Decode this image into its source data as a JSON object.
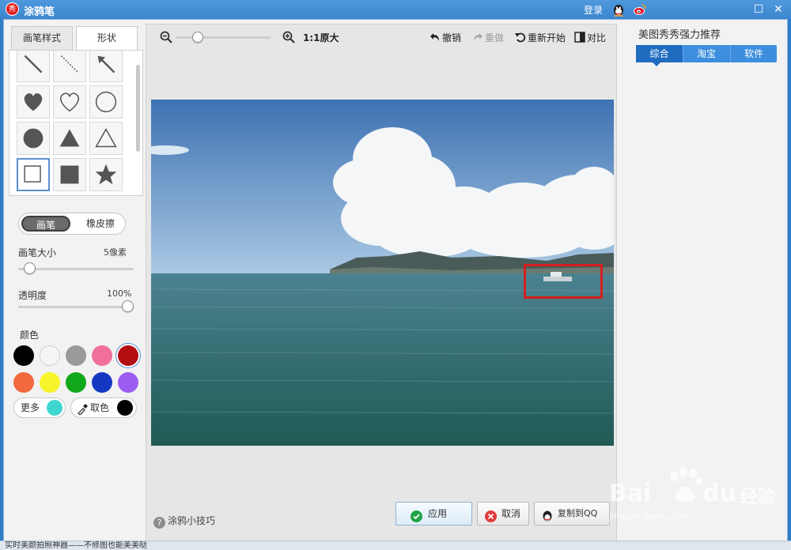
{
  "window": {
    "title": "涂鸦笔",
    "logo_text": "秀",
    "login": "登录",
    "qq_icon": "qq-penguin-icon",
    "weibo_icon": "weibo-icon",
    "maximize_symbol": "☐",
    "close_symbol": "✕"
  },
  "left": {
    "tabs": [
      "画笔样式",
      "形状"
    ],
    "active_tab": "形状",
    "shapes": [
      "line",
      "dashed-line",
      "arrow",
      "heart-filled",
      "heart-outline",
      "circle-outline",
      "circle-filled",
      "triangle-filled",
      "triangle-outline",
      "square-outline",
      "square-filled",
      "star-filled"
    ],
    "selected_shape": "square-outline",
    "mode": {
      "brush": "画笔",
      "eraser": "橡皮擦",
      "active": "画笔"
    },
    "brush_size": {
      "label": "画笔大小",
      "value_text": "5像素",
      "level": 0.05
    },
    "opacity": {
      "label": "透明度",
      "value_text": "100%",
      "level": 1.0
    },
    "color_label": "颜色",
    "colors": [
      "#000000",
      "#f5f5f5",
      "#9a9a9a",
      "#f0709a",
      "#b30e12",
      "#f2683f",
      "#f7f42a",
      "#12a81c",
      "#1438c2",
      "#9c5cf0"
    ],
    "selected_color": "#b30e12",
    "more": {
      "label": "更多",
      "color": "#3fd6cf"
    },
    "picker": {
      "label": "取色",
      "color": "#000000"
    }
  },
  "center": {
    "zoom_label": "1:1原大",
    "zoom_level": 0.2,
    "undo": "撤销",
    "redo": "重做",
    "restart": "重新开始",
    "compare": "对比",
    "tips": "涂鸦小技巧",
    "buttons": {
      "apply": "应用",
      "cancel": "取消",
      "copy_qq": "复制到QQ"
    },
    "annotation_color": "#d41e1e"
  },
  "right": {
    "title": "美图秀秀强力推荐",
    "tabs": [
      "综合",
      "淘宝",
      "软件"
    ],
    "active_tab": "综合"
  },
  "status": "实时美颜拍照神器——不修图也能美美哒",
  "watermark": {
    "brand": "Bai",
    "brand2": "du",
    "product": "经验",
    "url": "jingyan.baidu.com"
  }
}
